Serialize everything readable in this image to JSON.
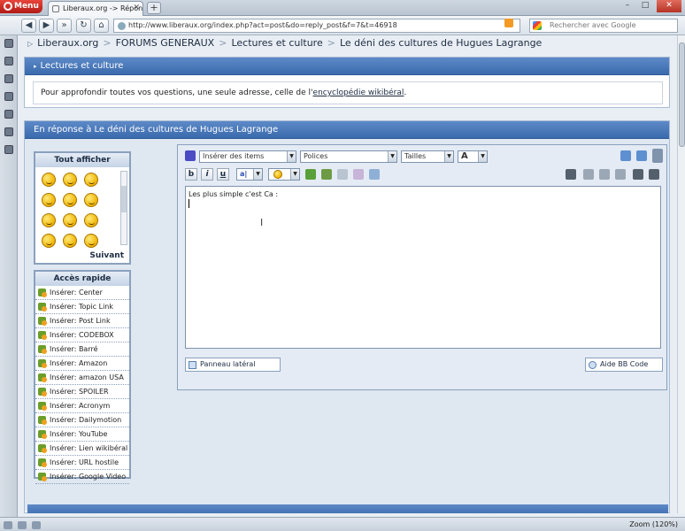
{
  "browser": {
    "menu_label": "Menu",
    "tab_title": "Liberaux.org -> Répon...",
    "url": "http://www.liberaux.org/index.php?act=post&do=reply_post&f=7&t=46918",
    "search_placeholder": "Rechercher avec Google",
    "zoom_label": "Zoom (120%)"
  },
  "breadcrumb": {
    "items": [
      "Liberaux.org",
      "FORUMS GENERAUX",
      "Lectures et culture",
      "Le déni des cultures de Hugues Lagrange"
    ]
  },
  "forum_panel": {
    "title": "Lectures et culture",
    "intro_text": "Pour approfondir toutes vos questions, une seule adresse, celle de l'",
    "intro_link": "encyclopédie wikibéral",
    "intro_end": "."
  },
  "reply_panel": {
    "title": "En réponse à Le déni des cultures de Hugues Lagrange"
  },
  "emoticons": {
    "title": "Tout afficher",
    "next_label": "Suivant",
    "icons": [
      "smiley-icon",
      "smiley-icon",
      "smiley-icon",
      "smiley-icon",
      "smiley-icon",
      "smiley-icon",
      "smiley-icon",
      "smiley-icon",
      "smiley-icon",
      "smiley-icon",
      "smiley-icon",
      "smiley-icon"
    ]
  },
  "quick_access": {
    "title": "Accès rapide",
    "items": [
      "Insérer: Center",
      "Insérer: Topic Link",
      "Insérer: Post Link",
      "Insérer: CODEBOX",
      "Insérer: Barré",
      "Insérer: Amazon",
      "Insérer: amazon USA",
      "Insérer: SPOILER",
      "Insérer: Acronym",
      "Insérer: Dailymotion",
      "Insérer: YouTube",
      "Insérer: Lien wikibéral",
      "Insérer: URL hostile",
      "Insérer: Google Video"
    ]
  },
  "editor": {
    "insert_items": "Insérer des items",
    "fonts": "Polices",
    "sizes": "Tailles",
    "font_color": "A",
    "bold": "b",
    "italic": "i",
    "underline": "u",
    "text_content": "Les plus simple c'est Ca :",
    "side_panel_button": "Panneau latéral",
    "bbcode_help_button": "Aide BB Code"
  },
  "colors": {
    "header_blue": "#3b6bad",
    "panel_bg": "#dfe7f1"
  }
}
